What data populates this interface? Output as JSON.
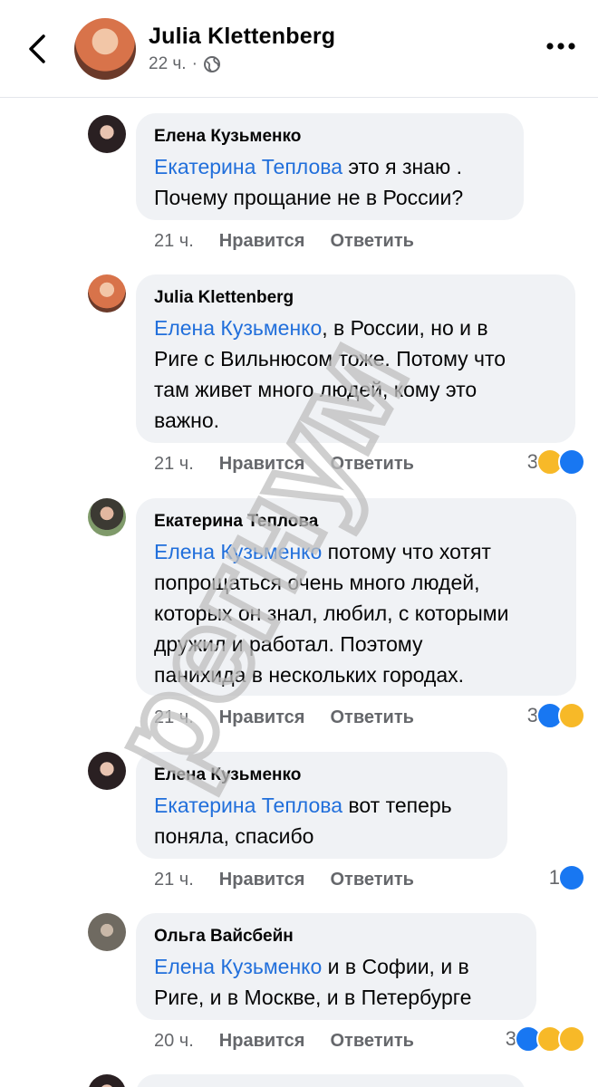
{
  "header": {
    "title": "Julia Klettenberg",
    "time": "22 ч.",
    "separator": "·",
    "back_icon": "chevron-left-icon",
    "privacy_icon": "globe-icon",
    "more_icon": "more-dots-icon"
  },
  "colors": {
    "mention": "#216fdb",
    "bubble": "#f0f2f5",
    "secondary": "#65676b",
    "like": "#1877f2"
  },
  "comments": [
    {
      "author": "Елена Кузьменко",
      "mention": "Екатерина Теплова",
      "text_lines": [
        " это я знаю .",
        "Почему прощание не в России?"
      ],
      "time": "21 ч.",
      "like": "Нравится",
      "reply": "Ответить",
      "reaction_count": "",
      "reactions": []
    },
    {
      "author": "Julia Klettenberg",
      "mention": "Елена Кузьменко",
      "text_lines": [
        ", в России, но и в",
        "Риге с Вильнюсом тоже. Потому что",
        "там живет много людей, кому это",
        "важно."
      ],
      "time": "21 ч.",
      "like": "Нравится",
      "reply": "Ответить",
      "reaction_count": "3",
      "reactions": [
        "care",
        "like"
      ]
    },
    {
      "author": "Екатерина Теплова",
      "mention": "Елена Кузьменко",
      "text_lines": [
        " потому что хотят",
        "попрощаться очень много людей,",
        "которых он знал, любил, с которыми",
        "дружил и работал. Поэтому",
        "панихида в нескольких городах."
      ],
      "time": "21 ч.",
      "like": "Нравится",
      "reply": "Ответить",
      "reaction_count": "3",
      "reactions": [
        "like",
        "care"
      ]
    },
    {
      "author": "Елена Кузьменко",
      "mention": "Екатерина Теплова",
      "text_lines": [
        " вот теперь",
        "поняла, спасибо"
      ],
      "time": "21 ч.",
      "like": "Нравится",
      "reply": "Ответить",
      "reaction_count": "1",
      "reactions": [
        "like"
      ]
    },
    {
      "author": "Ольга Вайсбейн",
      "mention": "Елена Кузьменко",
      "text_lines": [
        " и в Софии, и в",
        "Риге, и в Москве, и в Петербурге"
      ],
      "time": "20 ч.",
      "like": "Нравится",
      "reply": "Ответить",
      "reaction_count": "3",
      "reactions": [
        "like",
        "care",
        "sad"
      ]
    }
  ],
  "watermark": {
    "text": "регнум"
  }
}
